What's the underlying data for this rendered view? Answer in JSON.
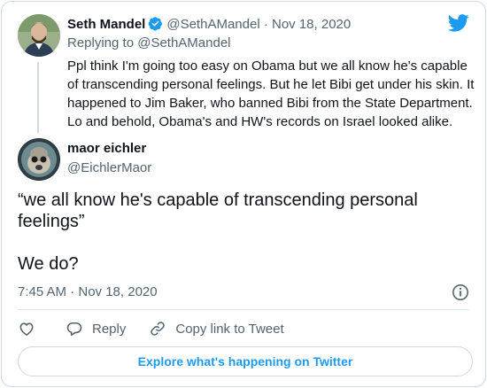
{
  "tweet_parent": {
    "author_name": "Seth Mandel",
    "author_handle": "@SethAMandel",
    "separator": "·",
    "date": "Nov 18, 2020",
    "replying_to_prefix": "Replying to",
    "replying_to_handle": "@SethAMandel",
    "text_lines": [
      "Ppl think I'm going too easy on Obama but we all know he's capable",
      "of transcending personal feelings. But he let Bibi get under his skin. It",
      "happened to Jim Baker, who banned Bibi from the State Department.",
      "Lo and behold, Obama's and HW's records on Israel looked alike."
    ]
  },
  "tweet_main": {
    "author_name": "maor eichler",
    "author_handle": "@EichlerMaor",
    "text_line_1": "“we all know he's capable of transcending personal",
    "text_line_2": "feelings”",
    "text_line_3": "We do?",
    "timestamp": "7:45 AM · Nov 18, 2020"
  },
  "actions": {
    "reply_label": "Reply",
    "copy_label": "Copy link to Tweet"
  },
  "footer": {
    "explore_label": "Explore what's happening on Twitter"
  },
  "colors": {
    "accent": "#1d9bf0",
    "muted": "#536471",
    "border": "#cfd9de"
  }
}
